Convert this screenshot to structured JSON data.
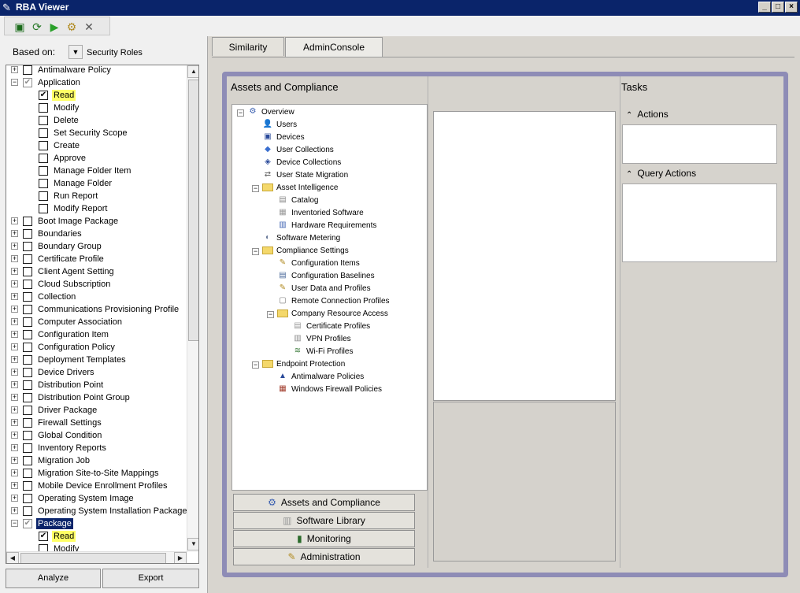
{
  "window": {
    "title": "RBA Viewer"
  },
  "toolbar": {
    "icons": [
      "console-icon",
      "refresh-icon",
      "run-icon",
      "settings-icon",
      "close-icon"
    ]
  },
  "based_on": {
    "label": "Based on:",
    "value": "Security Roles"
  },
  "left_tree": [
    {
      "label": "Antimalware Policy",
      "level": 0,
      "exp": "+",
      "cb": ""
    },
    {
      "label": "Application",
      "level": 0,
      "exp": "−",
      "cb": "gray-check"
    },
    {
      "label": "Read",
      "level": 1,
      "exp": "",
      "cb": "check",
      "hl": true
    },
    {
      "label": "Modify",
      "level": 1,
      "exp": "",
      "cb": ""
    },
    {
      "label": "Delete",
      "level": 1,
      "exp": "",
      "cb": ""
    },
    {
      "label": "Set Security Scope",
      "level": 1,
      "exp": "",
      "cb": ""
    },
    {
      "label": "Create",
      "level": 1,
      "exp": "",
      "cb": ""
    },
    {
      "label": "Approve",
      "level": 1,
      "exp": "",
      "cb": ""
    },
    {
      "label": "Manage Folder Item",
      "level": 1,
      "exp": "",
      "cb": ""
    },
    {
      "label": "Manage Folder",
      "level": 1,
      "exp": "",
      "cb": ""
    },
    {
      "label": "Run Report",
      "level": 1,
      "exp": "",
      "cb": ""
    },
    {
      "label": "Modify Report",
      "level": 1,
      "exp": "",
      "cb": ""
    },
    {
      "label": "Boot Image Package",
      "level": 0,
      "exp": "+",
      "cb": ""
    },
    {
      "label": "Boundaries",
      "level": 0,
      "exp": "+",
      "cb": ""
    },
    {
      "label": "Boundary Group",
      "level": 0,
      "exp": "+",
      "cb": ""
    },
    {
      "label": "Certificate Profile",
      "level": 0,
      "exp": "+",
      "cb": ""
    },
    {
      "label": "Client Agent Setting",
      "level": 0,
      "exp": "+",
      "cb": ""
    },
    {
      "label": "Cloud Subscription",
      "level": 0,
      "exp": "+",
      "cb": ""
    },
    {
      "label": "Collection",
      "level": 0,
      "exp": "+",
      "cb": ""
    },
    {
      "label": "Communications Provisioning Profile",
      "level": 0,
      "exp": "+",
      "cb": ""
    },
    {
      "label": "Computer Association",
      "level": 0,
      "exp": "+",
      "cb": ""
    },
    {
      "label": "Configuration Item",
      "level": 0,
      "exp": "+",
      "cb": ""
    },
    {
      "label": "Configuration Policy",
      "level": 0,
      "exp": "+",
      "cb": ""
    },
    {
      "label": "Deployment Templates",
      "level": 0,
      "exp": "+",
      "cb": ""
    },
    {
      "label": "Device Drivers",
      "level": 0,
      "exp": "+",
      "cb": ""
    },
    {
      "label": "Distribution Point",
      "level": 0,
      "exp": "+",
      "cb": ""
    },
    {
      "label": "Distribution Point Group",
      "level": 0,
      "exp": "+",
      "cb": ""
    },
    {
      "label": "Driver Package",
      "level": 0,
      "exp": "+",
      "cb": ""
    },
    {
      "label": "Firewall Settings",
      "level": 0,
      "exp": "+",
      "cb": ""
    },
    {
      "label": "Global Condition",
      "level": 0,
      "exp": "+",
      "cb": ""
    },
    {
      "label": "Inventory Reports",
      "level": 0,
      "exp": "+",
      "cb": ""
    },
    {
      "label": "Migration Job",
      "level": 0,
      "exp": "+",
      "cb": ""
    },
    {
      "label": "Migration Site-to-Site Mappings",
      "level": 0,
      "exp": "+",
      "cb": ""
    },
    {
      "label": "Mobile Device Enrollment Profiles",
      "level": 0,
      "exp": "+",
      "cb": ""
    },
    {
      "label": "Operating System Image",
      "level": 0,
      "exp": "+",
      "cb": ""
    },
    {
      "label": "Operating System Installation Package",
      "level": 0,
      "exp": "+",
      "cb": ""
    },
    {
      "label": "Package",
      "level": 0,
      "exp": "−",
      "cb": "gray-check",
      "sel": true
    },
    {
      "label": "Read",
      "level": 1,
      "exp": "",
      "cb": "check",
      "hl": true
    },
    {
      "label": "Modify",
      "level": 1,
      "exp": "",
      "cb": ""
    }
  ],
  "buttons": {
    "analyze": "Analyze",
    "export": "Export"
  },
  "tabs": [
    "Similarity",
    "AdminConsole"
  ],
  "console": {
    "workspace_title": "Assets and Compliance",
    "tasks_title": "Tasks",
    "actions_label": "Actions",
    "query_actions_label": "Query Actions",
    "nav_tree": [
      {
        "label": "Overview",
        "depth": 0,
        "exp": "−",
        "icon": "overview-icon"
      },
      {
        "label": "Users",
        "depth": 1,
        "exp": "",
        "icon": "user-icon"
      },
      {
        "label": "Devices",
        "depth": 1,
        "exp": "",
        "icon": "device-icon"
      },
      {
        "label": "User Collections",
        "depth": 1,
        "exp": "",
        "icon": "user-collection-icon"
      },
      {
        "label": "Device Collections",
        "depth": 1,
        "exp": "",
        "icon": "device-collection-icon"
      },
      {
        "label": "User State Migration",
        "depth": 1,
        "exp": "",
        "icon": "migration-icon"
      },
      {
        "label": "Asset Intelligence",
        "depth": 1,
        "exp": "−",
        "icon": "folder-icon"
      },
      {
        "label": "Catalog",
        "depth": 2,
        "exp": "",
        "icon": "catalog-icon"
      },
      {
        "label": "Inventoried Software",
        "depth": 2,
        "exp": "",
        "icon": "software-icon"
      },
      {
        "label": "Hardware Requirements",
        "depth": 2,
        "exp": "",
        "icon": "hardware-icon"
      },
      {
        "label": "Software Metering",
        "depth": 1,
        "exp": "",
        "icon": "metering-icon"
      },
      {
        "label": "Compliance Settings",
        "depth": 1,
        "exp": "−",
        "icon": "folder-icon"
      },
      {
        "label": "Configuration Items",
        "depth": 2,
        "exp": "",
        "icon": "config-item-icon"
      },
      {
        "label": "Configuration Baselines",
        "depth": 2,
        "exp": "",
        "icon": "baseline-icon"
      },
      {
        "label": "User Data and Profiles",
        "depth": 2,
        "exp": "",
        "icon": "user-data-icon"
      },
      {
        "label": "Remote Connection Profiles",
        "depth": 2,
        "exp": "",
        "icon": "remote-icon"
      },
      {
        "label": "Company Resource Access",
        "depth": 2,
        "exp": "−",
        "icon": "folder-icon"
      },
      {
        "label": "Certificate Profiles",
        "depth": 3,
        "exp": "",
        "icon": "certificate-icon"
      },
      {
        "label": "VPN Profiles",
        "depth": 3,
        "exp": "",
        "icon": "vpn-icon"
      },
      {
        "label": "Wi-Fi Profiles",
        "depth": 3,
        "exp": "",
        "icon": "wifi-icon"
      },
      {
        "label": "Endpoint Protection",
        "depth": 1,
        "exp": "−",
        "icon": "folder-icon"
      },
      {
        "label": "Antimalware Policies",
        "depth": 2,
        "exp": "",
        "icon": "antimalware-icon"
      },
      {
        "label": "Windows Firewall Policies",
        "depth": 2,
        "exp": "",
        "icon": "firewall-icon"
      }
    ],
    "workspaces": [
      {
        "label": "Assets and Compliance",
        "icon": "assets-icon"
      },
      {
        "label": "Software Library",
        "icon": "library-icon"
      },
      {
        "label": "Monitoring",
        "icon": "monitoring-icon"
      },
      {
        "label": "Administration",
        "icon": "administration-icon"
      }
    ]
  }
}
